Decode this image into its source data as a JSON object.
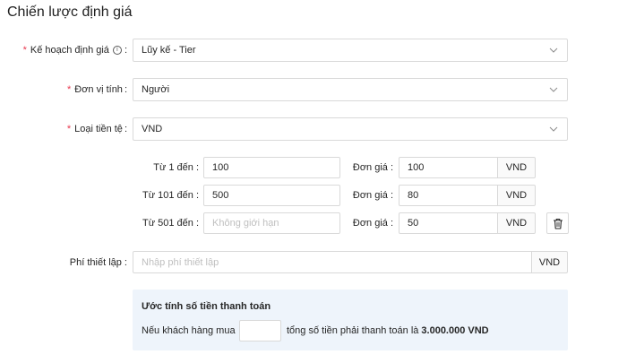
{
  "page": {
    "title": "Chiến lược định giá"
  },
  "form": {
    "plan": {
      "required_mark": "*",
      "label": "Kế hoạch định giá",
      "info_icon": "info-circle-icon",
      "colon": ":",
      "value": "Lũy kế - Tier"
    },
    "unit": {
      "required_mark": "*",
      "label": "Đơn vị tính",
      "colon": ":",
      "value": "Người"
    },
    "currency": {
      "required_mark": "*",
      "label": "Loại tiền tệ",
      "colon": ":",
      "value": "VND"
    },
    "tiers": [
      {
        "from_label": "Từ 1 đến :",
        "to_value": "100",
        "to_placeholder": "",
        "price_label": "Đơn giá :",
        "price_value": "100",
        "price_unit": "VND"
      },
      {
        "from_label": "Từ 101 đến :",
        "to_value": "500",
        "to_placeholder": "",
        "price_label": "Đơn giá :",
        "price_value": "80",
        "price_unit": "VND"
      },
      {
        "from_label": "Từ 501 đến :",
        "to_value": "",
        "to_placeholder": "Không giới hạn",
        "price_label": "Đơn giá :",
        "price_value": "50",
        "price_unit": "VND"
      }
    ],
    "setup_fee": {
      "label": "Phí thiết lập :",
      "placeholder": "Nhập phí thiết lập",
      "unit": "VND"
    }
  },
  "estimate": {
    "title": "Ước tính số tiền thanh toán",
    "prefix": "Nếu khách hàng mua",
    "suffix_text": "tổng số tiền phải thanh toán là",
    "total": "3.000.000 VND"
  },
  "colors": {
    "required": "#e8384f",
    "estimate_bg": "#eef4fb",
    "border": "#d9d9d9"
  }
}
